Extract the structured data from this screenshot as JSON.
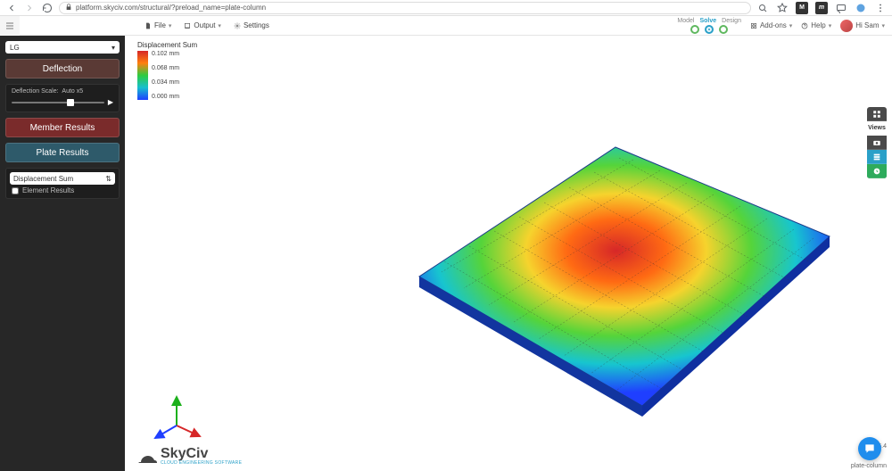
{
  "browser": {
    "url": "platform.skyciv.com/structural/?preload_name=plate-column",
    "ext1": "M",
    "ext2": "m"
  },
  "toolbar": {
    "file": "File",
    "output": "Output",
    "settings": "Settings",
    "tab_model": "Model",
    "tab_solve": "Solve",
    "tab_design": "Design",
    "addons": "Add-ons",
    "help": "Help",
    "username": "Hi Sam"
  },
  "sidebar": {
    "lg_label": "LG",
    "deflection": "Deflection",
    "deflection_scale_label": "Deflection Scale:",
    "deflection_scale_value": "Auto x5",
    "member_results": "Member Results",
    "plate_results": "Plate Results",
    "displacement_select": "Displacement Sum",
    "element_results": "Element Results"
  },
  "legend": {
    "title": "Displacement Sum",
    "vals": [
      "0.102 mm",
      "0.068 mm",
      "0.034 mm",
      "0.000 mm"
    ]
  },
  "right_tools": {
    "views": "Views"
  },
  "logo": {
    "name": "SkyCiv",
    "tagline": "CLOUD ENGINEERING SOFTWARE"
  },
  "footer": {
    "version": "v4.5.4",
    "model_name": "plate-column"
  },
  "chart_data": {
    "type": "heatmap",
    "title": "Displacement Sum",
    "units": "mm",
    "colorbar": {
      "min": 0.0,
      "max": 0.102,
      "ticks": [
        0.0,
        0.034,
        0.068,
        0.102
      ]
    },
    "description": "Square plate FEA displacement contour; peak near center (~0.102 mm) tapering radially to ~0 mm at the four corners."
  }
}
